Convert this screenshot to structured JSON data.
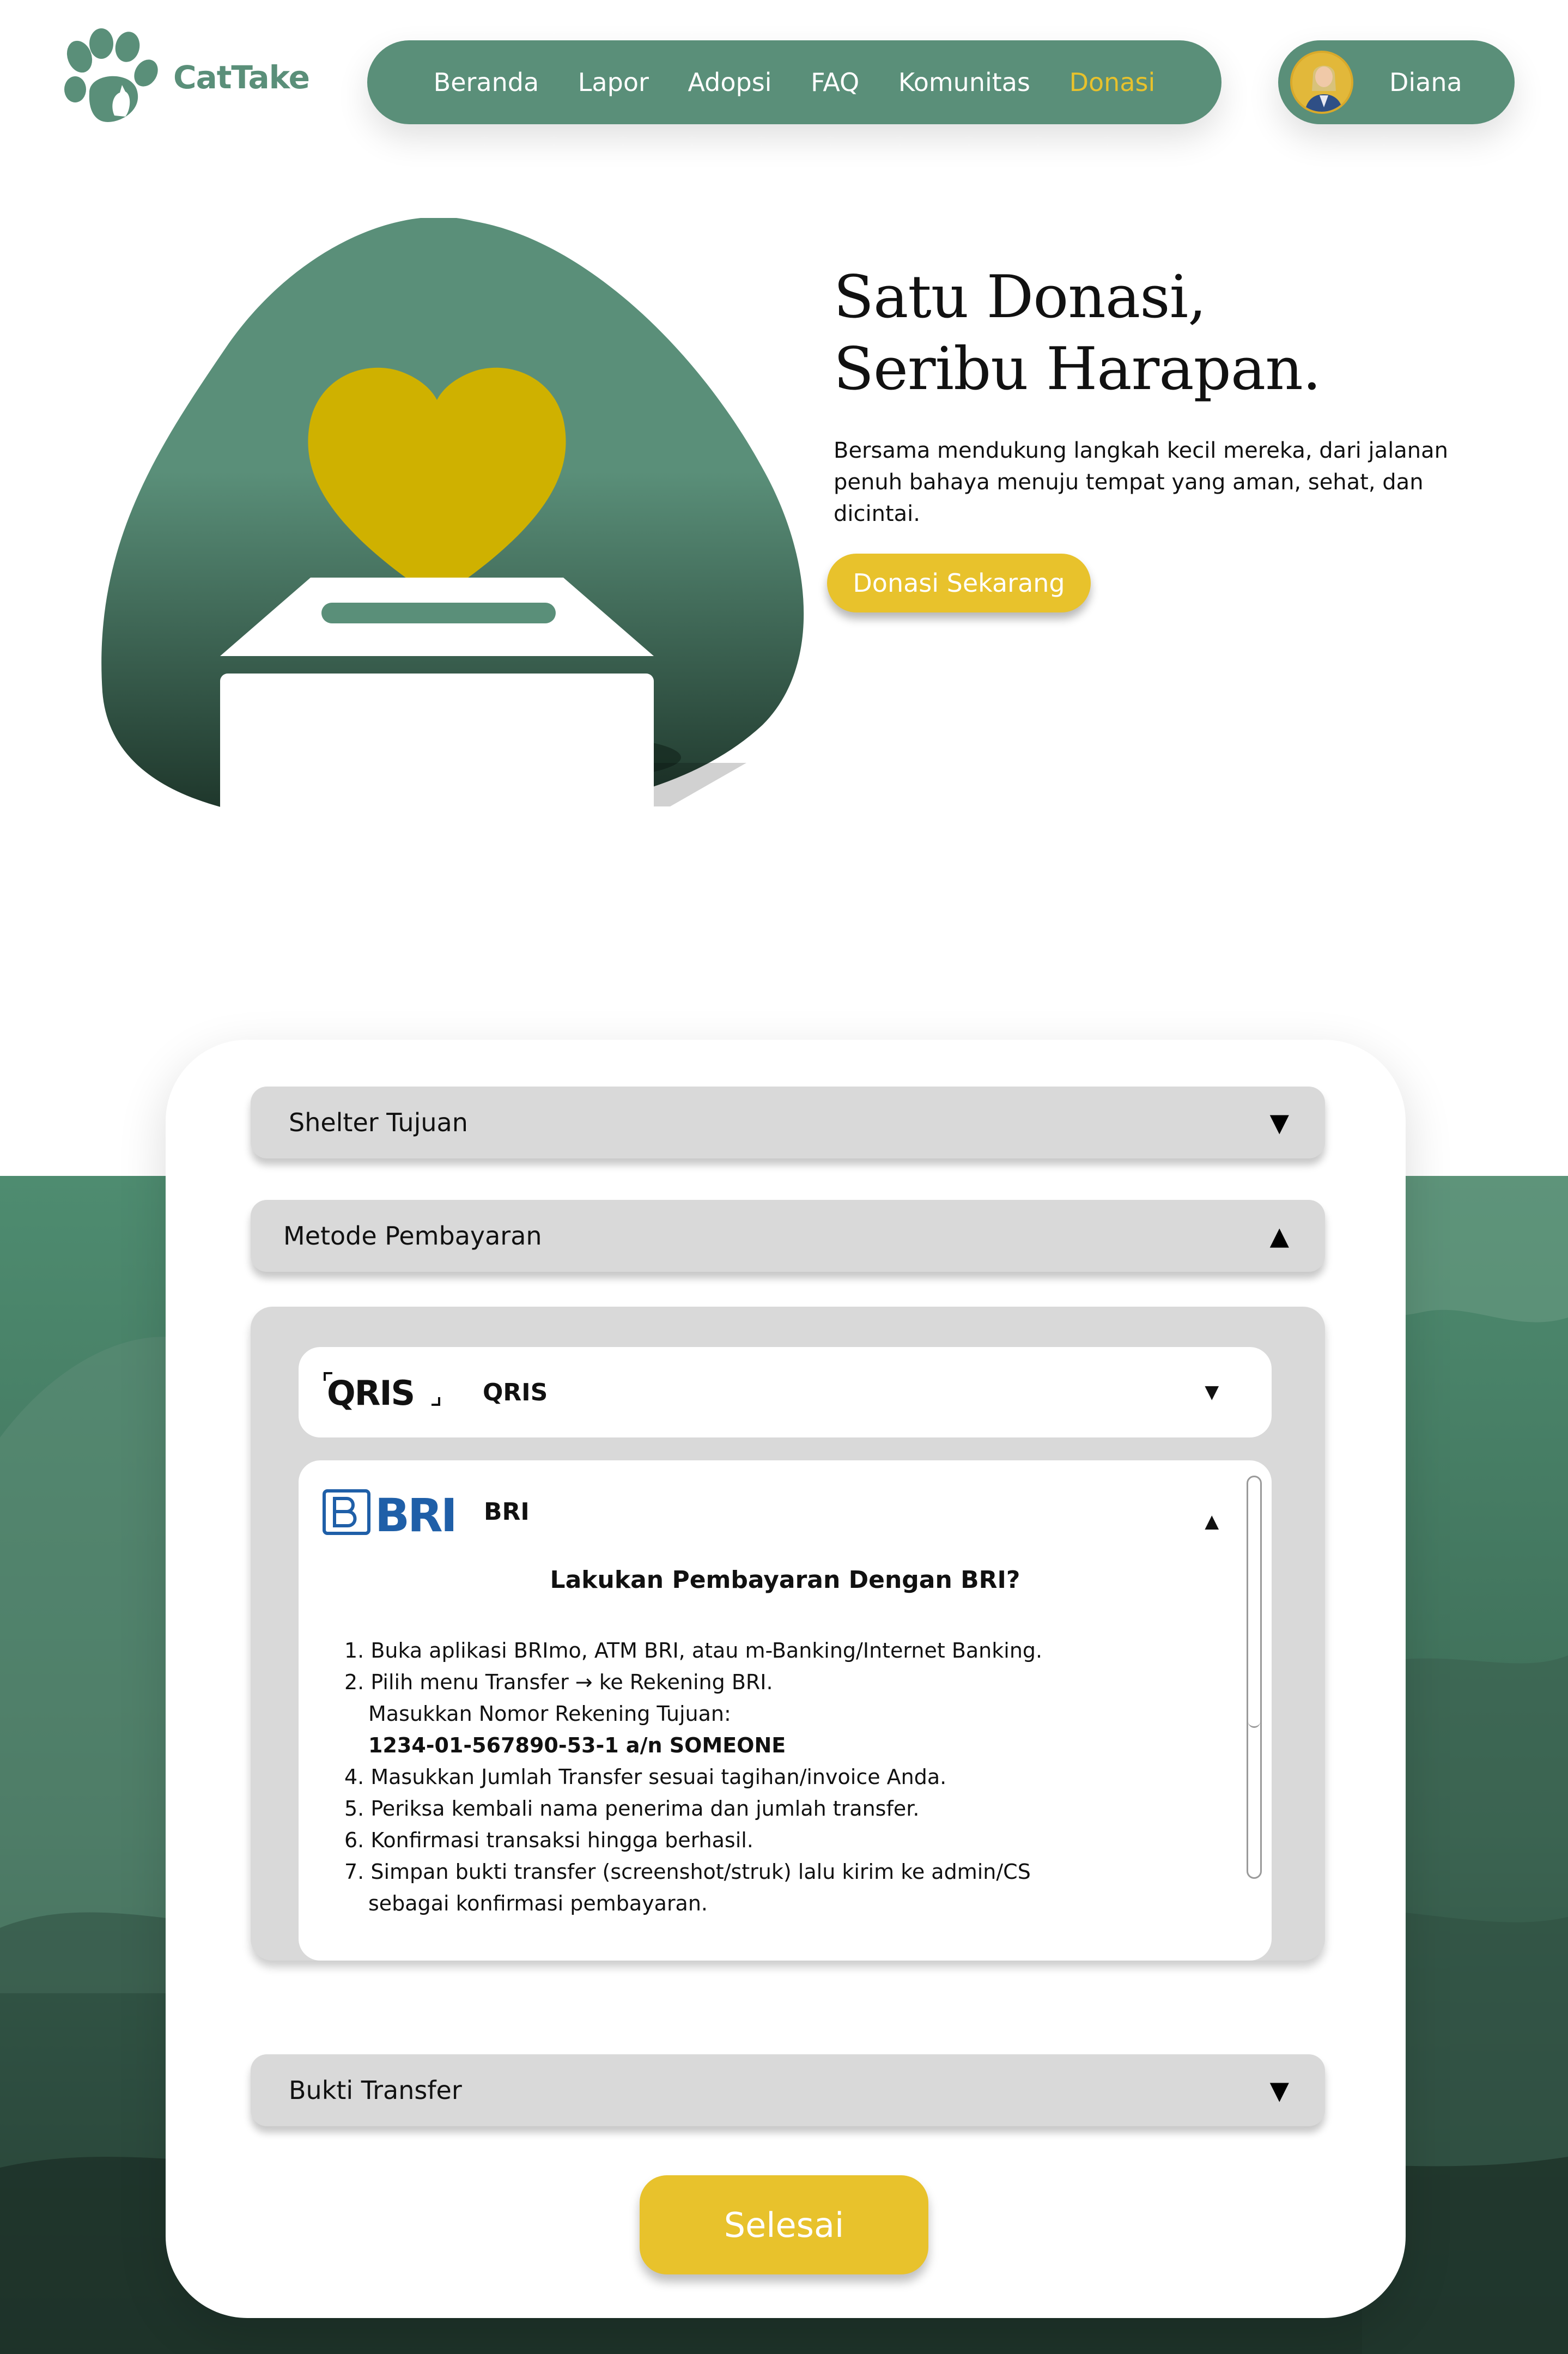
{
  "brand": {
    "name": "CatTake"
  },
  "nav": {
    "items": [
      {
        "label": "Beranda"
      },
      {
        "label": "Lapor"
      },
      {
        "label": "Adopsi"
      },
      {
        "label": "FAQ"
      },
      {
        "label": "Komunitas"
      },
      {
        "label": "Donasi",
        "active": true
      }
    ]
  },
  "user": {
    "name": "Diana"
  },
  "hero": {
    "title_line1": "Satu Donasi,",
    "title_line2": "Seribu Harapan.",
    "description": "Bersama mendukung langkah kecil mereka, dari jalanan penuh bahaya menuju tempat yang aman, sehat, dan dicintai.",
    "cta_label": "Donasi Sekarang"
  },
  "form": {
    "shelter": {
      "label": "Shelter Tujuan",
      "expanded": false
    },
    "payment": {
      "label": "Metode Pembayaran",
      "expanded": true,
      "methods": {
        "qris": {
          "logo_text": "QRIS",
          "label": "QRIS",
          "expanded": false
        },
        "bri": {
          "logo_text": "BRI",
          "label": "BRI",
          "expanded": true,
          "title": "Lakukan Pembayaran Dengan BRI?",
          "steps": [
            "1. Buka aplikasi BRImo, ATM BRI, atau m-Banking/Internet Banking.",
            "2. Pilih menu Transfer → ke Rekening BRI.",
            "Masukkan Nomor Rekening Tujuan:",
            "1234-01-567890-53-1 a/n SOMEONE",
            "4. Masukkan Jumlah Transfer sesuai tagihan/invoice Anda.",
            "5. Periksa kembali nama penerima dan jumlah transfer.",
            "6. Konfirmasi transaksi hingga berhasil.",
            "7. Simpan bukti transfer (screenshot/struk) lalu kirim ke admin/CS",
            "sebagai konfirmasi pembayaran."
          ]
        }
      }
    },
    "proof": {
      "label": "Bukti Transfer",
      "expanded": false
    },
    "submit_label": "Selesai"
  },
  "icons": {
    "collapsed": "▼",
    "expanded": "▲"
  },
  "colors": {
    "primary_green": "#5a8f79",
    "dark_green": "#1f3a2e",
    "accent_yellow": "#e8c22c",
    "heart_yellow": "#cfb100",
    "panel_grey": "#d9d9d9",
    "bri_blue": "#1f5fa8"
  }
}
